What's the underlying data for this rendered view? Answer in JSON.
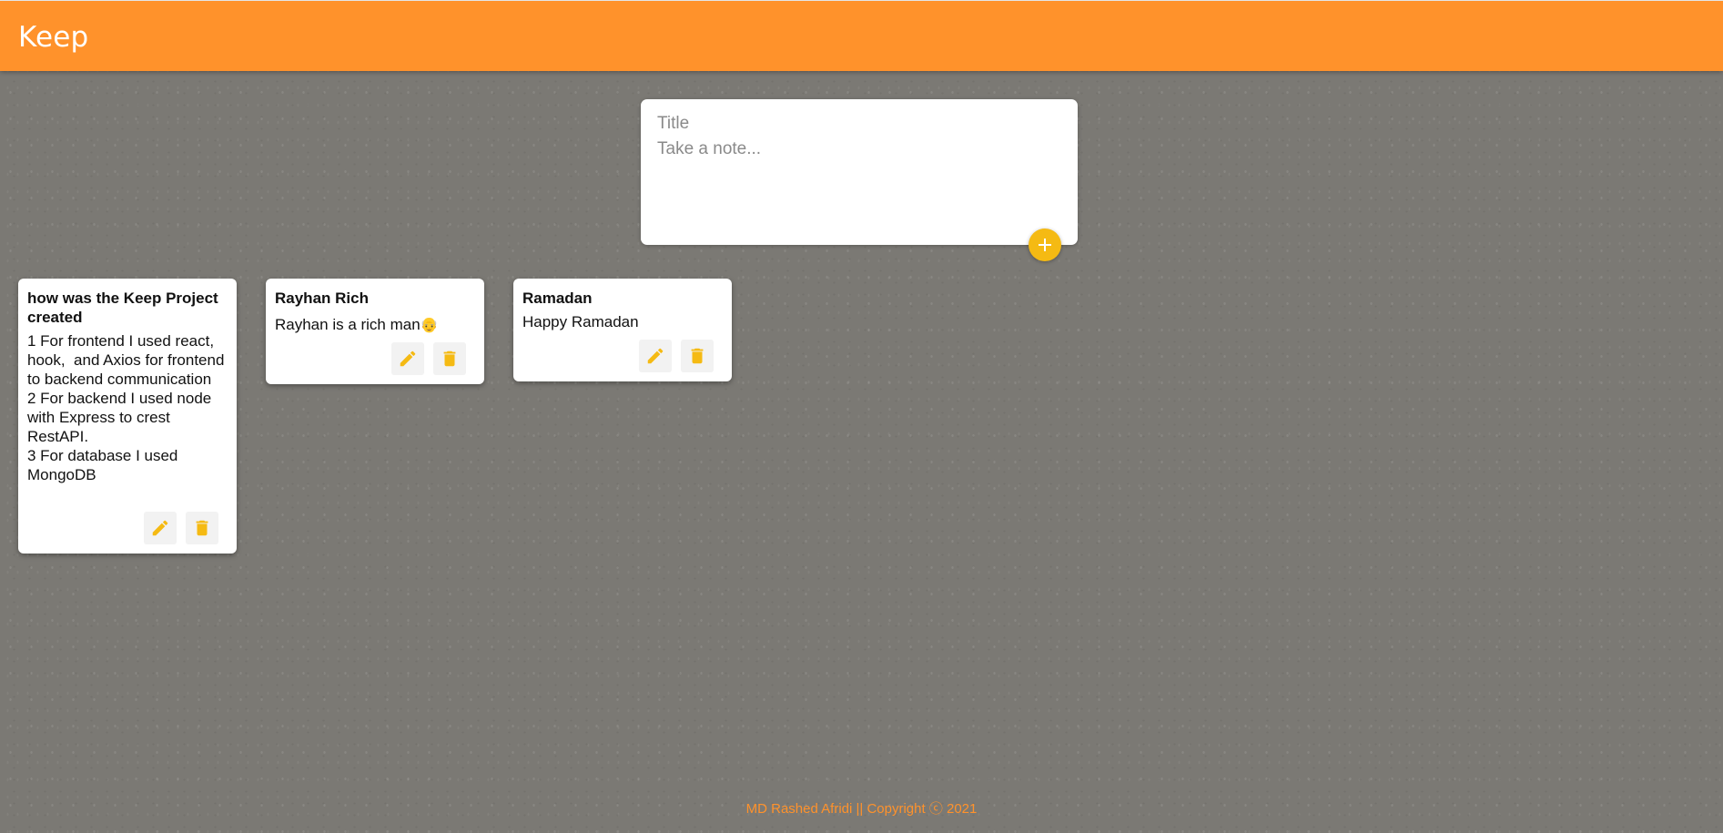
{
  "app": {
    "title": "Keep",
    "accent_color": "#ff922b",
    "button_color": "#f5ba13"
  },
  "create_note": {
    "title_placeholder": "Title",
    "content_placeholder": "Take a note...",
    "title_value": "",
    "content_value": "",
    "add_icon": "plus-icon"
  },
  "notes": [
    {
      "title": "how was the Keep Project created",
      "content": "1 For frontend I used react, hook,  and Axios for frontend to backend communication\n2 For backend I used node with Express to crest RestAPI.\n3 For database I used MongoDB",
      "edit_icon": "pencil-icon",
      "delete_icon": "trash-icon"
    },
    {
      "title": "Rayhan Rich",
      "content": "Rayhan is a rich man",
      "emoji": "👴",
      "edit_icon": "pencil-icon",
      "delete_icon": "trash-icon"
    },
    {
      "title": "Ramadan",
      "content": "Happy Ramadan",
      "edit_icon": "pencil-icon",
      "delete_icon": "trash-icon"
    }
  ],
  "footer": {
    "text": "MD Rashed Afridi || Copyright ⓒ 2021"
  }
}
